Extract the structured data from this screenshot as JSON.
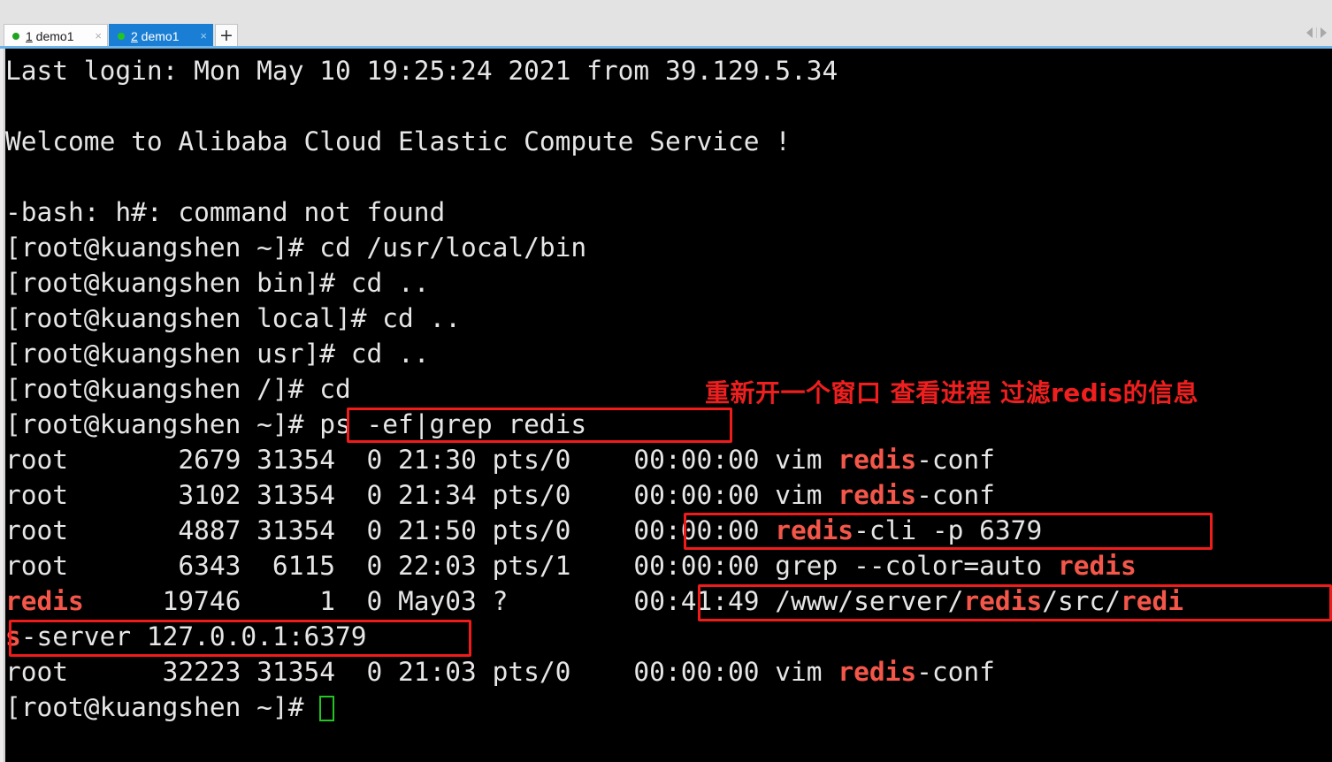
{
  "window": {
    "tabs": [
      {
        "index": "1",
        "label": " demo1",
        "state": "inactive",
        "close_icon": "×",
        "status": "running"
      },
      {
        "index": "2",
        "label": " demo1",
        "state": "active",
        "close_icon": "×",
        "status": "running"
      }
    ],
    "new_tab_label": "+",
    "scroll_left_icon": "left-arrow",
    "scroll_right_icon": "right-arrow"
  },
  "terminal": {
    "lines": [
      {
        "text": "Last login: Mon May 10 19:25:24 2021 from 39.129.5.34"
      },
      {
        "text": ""
      },
      {
        "text": "Welcome to Alibaba Cloud Elastic Compute Service !"
      },
      {
        "text": ""
      },
      {
        "text": "-bash: h#: command not found"
      },
      {
        "text": "[root@kuangshen ~]# cd /usr/local/bin"
      },
      {
        "text": "[root@kuangshen bin]# cd .."
      },
      {
        "text": "[root@kuangshen local]# cd .."
      },
      {
        "text": "[root@kuangshen usr]# cd .."
      },
      {
        "text": "[root@kuangshen /]# cd"
      },
      {
        "text": "[root@kuangshen ~]# ps -ef|grep redis"
      },
      {
        "text": "root       2679 31354  0 21:30 pts/0    00:00:00 vim redis-conf"
      },
      {
        "text": "root       3102 31354  0 21:34 pts/0    00:00:00 vim redis-conf"
      },
      {
        "text": "root       4887 31354  0 21:50 pts/0    00:00:00 redis-cli -p 6379"
      },
      {
        "text": "root       6343  6115  0 22:03 pts/1    00:00:00 grep --color=auto redis"
      },
      {
        "text": "redis     19746     1  0 May03 ?        00:41:49 /www/server/redis/src/redi"
      },
      {
        "text": "s-server 127.0.0.1:6379"
      },
      {
        "text": "root      32223 31354  0 21:03 pts/0    00:00:00 vim redis-conf"
      },
      {
        "text": "[root@kuangshen ~]# "
      }
    ],
    "segments": {
      "l0": "Last login: Mon May 10 19:25:24 2021 from 39.129.5.34",
      "l2": "Welcome to Alibaba Cloud Elastic Compute Service !",
      "l4": "-bash: h#: command not found",
      "l5": "[root@kuangshen ~]# cd /usr/local/bin",
      "l6": "[root@kuangshen bin]# cd ..",
      "l7": "[root@kuangshen local]# cd ..",
      "l8": "[root@kuangshen usr]# cd ..",
      "l9": "[root@kuangshen /]# cd",
      "l10_prompt": "[root@kuangshen ~]# ",
      "l10_cmd": "ps -ef|grep redis",
      "r1_pre": "root       2679 31354  0 21:30 pts/0    00:00:00 vim ",
      "r1_hl": "redis",
      "r1_post": "-conf",
      "r2_pre": "root       3102 31354  0 21:34 pts/0    00:00:00 vim ",
      "r2_hl": "redis",
      "r2_post": "-conf",
      "r3_pre": "root       4887 31354  0 21:50 pts/0    00:00:00 ",
      "r3_hl": "redis",
      "r3_post": "-cli -p 6379",
      "r4_pre": "root       6343  6115  0 22:03 pts/1    00:00:00 grep --color=auto ",
      "r4_hl": "redis",
      "r5_hl": "redis",
      "r5_mid": "     19746     1  0 May03 ?        00:41:49 /www/server/",
      "r5_hl2": "redis",
      "r5_mid2": "/src/",
      "r5_hl3": "redi",
      "r6_hl": "s",
      "r6_post": "-server 127.0.0.1:6379",
      "r7_pre": "root      32223 31354  0 21:03 pts/0    00:00:00 vim ",
      "r7_hl": "redis",
      "r7_post": "-conf",
      "l18_prompt": "[root@kuangshen ~]# "
    },
    "cursor": "block-cursor"
  },
  "annotations": {
    "note_cn": "重新开一个窗口 查看进程 过滤redis的信息",
    "note_color": "#ef1f1f",
    "boxes": [
      {
        "name": "box-ps-command"
      },
      {
        "name": "box-redis-cli"
      },
      {
        "name": "box-redis-server-path"
      },
      {
        "name": "box-redis-server-addr"
      }
    ]
  }
}
